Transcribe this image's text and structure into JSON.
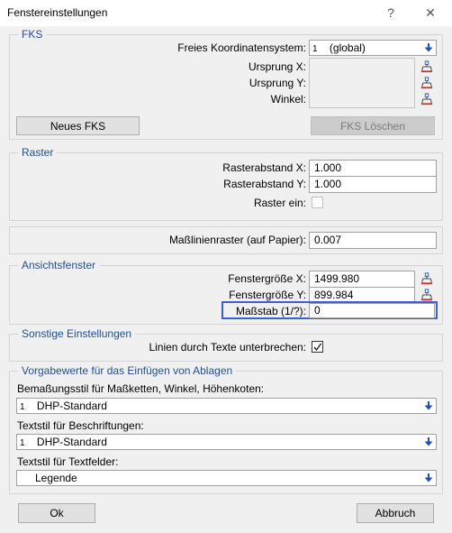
{
  "window": {
    "title": "Fenstereinstellungen",
    "help": "?",
    "close": "✕"
  },
  "fks": {
    "legend": "FKS",
    "koord_label": "Freies Koordinatensystem:",
    "koord_index": "1",
    "koord_value": "(global)",
    "ursprung_x_label": "Ursprung X:",
    "ursprung_y_label": "Ursprung Y:",
    "winkel_label": "Winkel:",
    "neues_btn": "Neues FKS",
    "loeschen_btn": "FKS Löschen"
  },
  "raster": {
    "legend": "Raster",
    "abstand_x_label": "Rasterabstand X:",
    "abstand_x_value": "1.000",
    "abstand_y_label": "Rasterabstand Y:",
    "abstand_y_value": "1.000",
    "raster_ein_label": "Raster ein:"
  },
  "masslinien": {
    "label": "Maßlinienraster (auf Papier):",
    "value": "0.007"
  },
  "ansicht": {
    "legend": "Ansichtsfenster",
    "groesse_x_label": "Fenstergröße X:",
    "groesse_x_value": "1499.980",
    "groesse_y_label": "Fenstergröße Y:",
    "groesse_y_value": "899.984",
    "massstab_label": "Maßstab (1/?):",
    "massstab_value": "0"
  },
  "sonstige": {
    "legend": "Sonstige Einstellungen",
    "linien_label": "Linien durch Texte unterbrechen:",
    "linien_checked": true
  },
  "vorgabe": {
    "legend": "Vorgabewerte für das Einfügen von Ablagen",
    "bemassung_label": "Bemaßungsstil für Maßketten, Winkel, Höhenkoten:",
    "bemassung_index": "1",
    "bemassung_value": "DHP-Standard",
    "textstil_label": "Textstil für Beschriftungen:",
    "textstil_index": "1",
    "textstil_value": "DHP-Standard",
    "textfelder_label": "Textstil für Textfelder:",
    "textfelder_value": "Legende"
  },
  "footer": {
    "ok": "Ok",
    "abbruch": "Abbruch"
  },
  "colors": {
    "legend": "#1f4e9a",
    "highlight": "#3c5fd6",
    "arrow": "#1a4fc4"
  }
}
